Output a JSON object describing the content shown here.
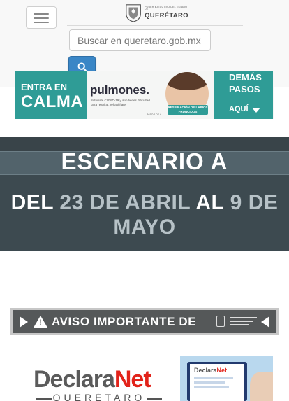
{
  "header": {
    "menu_toggle_label": "Toggle navigation",
    "logo": {
      "small": "PODER EJECUTIVO DEL ESTADO DE",
      "big": "QUERÉTARO"
    },
    "search": {
      "placeholder": "Buscar en queretaro.gob.mx",
      "value": ""
    },
    "search_button_icon": "search-icon"
  },
  "banner_top": {
    "left_line1": "ENTRA EN",
    "left_line2": "CALMA",
    "middle_heading": "pulmones.",
    "middle_sub": "Si tuviste COVID-19 y aún tienes dificultad para respirar, rehabilítate.",
    "step": "PASO 1 DE 6",
    "badge": "RESPIRACIÓN DE LABIOS FRUNCIDOS",
    "right_line1": "DEMÁS",
    "right_line2": "PASOS",
    "right_line3": "AQUÍ"
  },
  "scenario": {
    "title": "ESCENARIO A",
    "del": "DEL",
    "start_date": "23 DE ABRIL",
    "al": "AL",
    "end_date_num": "9 DE",
    "end_date_month": "MAYO"
  },
  "aviso": {
    "text": "AVISO IMPORTANTE DE"
  },
  "declaranet": {
    "logo_part1": "Declara",
    "logo_part2": "Net",
    "subtitle": "QUERÉTARO",
    "screen_part1": "Declara",
    "screen_part2": "Net"
  },
  "colors": {
    "header_bg": "#f8f8f8",
    "search_button": "#3a86c6",
    "banner_teal": "#2f9c96",
    "scenario_bg": "#3d4a50",
    "scenario_band": "#52636b",
    "scenario_highlight": "#b7c2c7",
    "aviso_bg": "#555859",
    "declaranet_red": "#e2231a"
  }
}
